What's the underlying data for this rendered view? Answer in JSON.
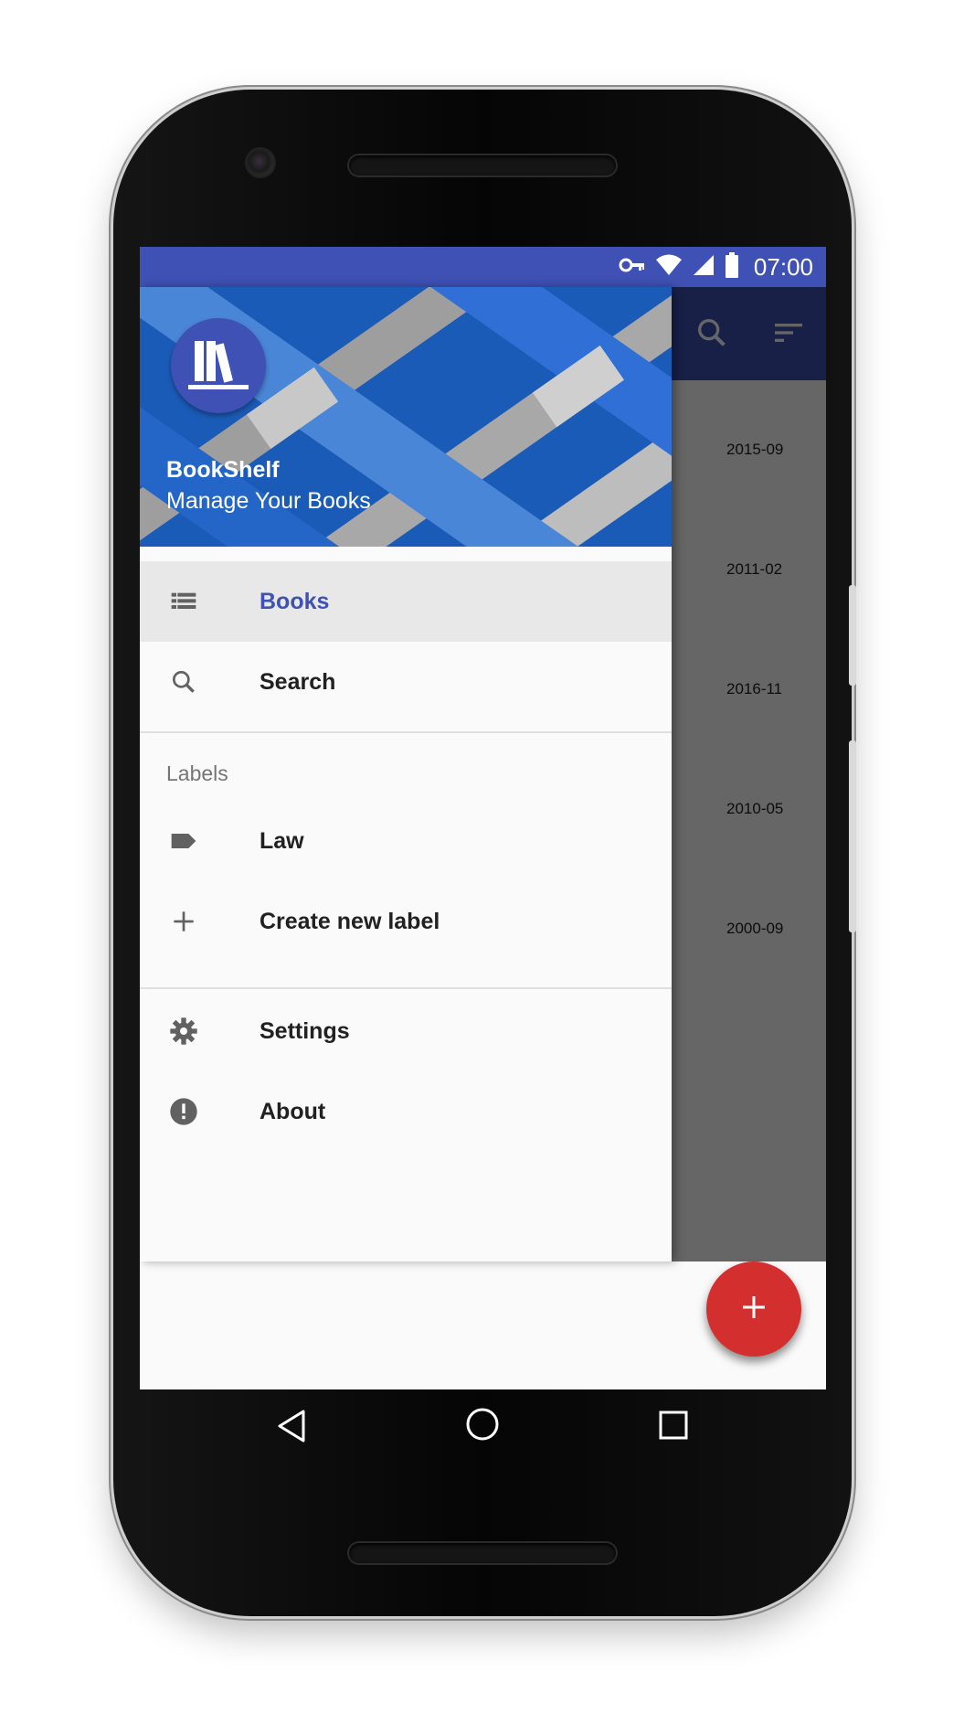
{
  "status_bar": {
    "time": "07:00",
    "icons": [
      "vpn-key-icon",
      "wifi-icon",
      "signal-icon",
      "battery-icon"
    ]
  },
  "toolbar": {
    "icons": [
      "search-icon",
      "sort-icon"
    ]
  },
  "list_dates": [
    "2015-09",
    "2011-02",
    "2016-11",
    "2010-05",
    "2000-09"
  ],
  "fab": {
    "icon": "plus-icon"
  },
  "drawer": {
    "header": {
      "title": "BookShelf",
      "subtitle": "Manage Your Books",
      "avatar_icon": "books-icon"
    },
    "items": [
      {
        "label": "Books",
        "icon": "list-icon",
        "active": true
      },
      {
        "label": "Search",
        "icon": "search-icon",
        "active": false
      }
    ],
    "labels_section": {
      "title": "Labels",
      "items": [
        {
          "label": "Law",
          "icon": "label-tag-icon"
        },
        {
          "label": "Create new label",
          "icon": "plus-icon"
        }
      ]
    },
    "footer_items": [
      {
        "label": "Settings",
        "icon": "gear-icon"
      },
      {
        "label": "About",
        "icon": "info-alert-icon"
      }
    ]
  },
  "nav_bar": {
    "buttons": [
      "back-icon",
      "home-icon",
      "recents-icon"
    ]
  },
  "colors": {
    "primary": "#3f51b5",
    "accent": "#d32f2f",
    "header_blue": "#1e5ab0",
    "active_item_bg": "#e8e8e8"
  }
}
